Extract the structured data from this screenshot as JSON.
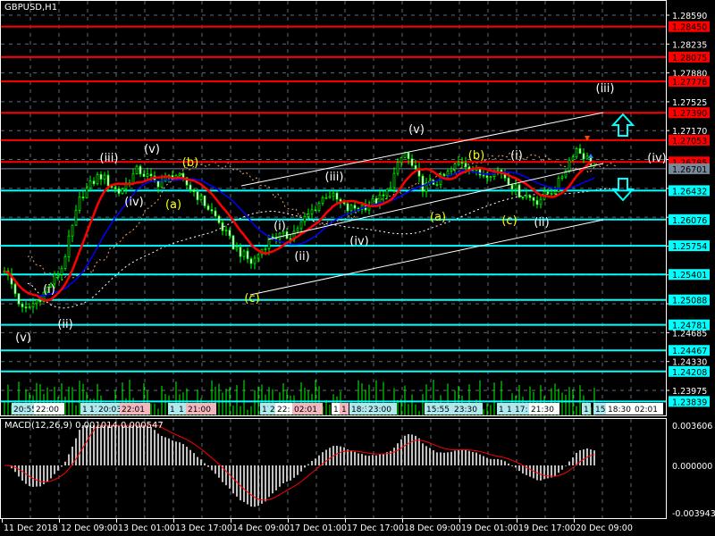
{
  "window": {
    "title": "GBPUSD,H1"
  },
  "macd_title": "MACD(12,26,9) 0.001014 0.000547",
  "colors": {
    "background": "#000000",
    "red_level": "#ff0000",
    "cyan_level": "#00ffff",
    "bull": "#00ff00",
    "wave_white": "#ffffff",
    "wave_yellow": "#ffff00",
    "ma_red": "#ff0000",
    "ma_blue": "#0000ff",
    "histogram": "#c0c0c0",
    "grid": "#5f6b7a"
  },
  "chart_data": {
    "type": "candlestick",
    "symbol": "GBPUSD",
    "timeframe": "H1",
    "ylim": [
      1.2372,
      1.2868
    ],
    "y_ticks": [
      "1.28590",
      "1.28235",
      "1.27880",
      "1.27525",
      "1.27170",
      "1.24685",
      "1.24330",
      "1.23975"
    ],
    "x_ticks": [
      "11 Dec 2018",
      "12 Dec 09:00",
      "13 Dec 01:00",
      "13 Dec 17:00",
      "14 Dec 09:00",
      "17 Dec 01:00",
      "17 Dec 17:00",
      "18 Dec 09:00",
      "19 Dec 01:00",
      "19 Dec 17:00",
      "20 Dec 09:00"
    ],
    "close_anchors": [
      1.2548,
      1.2493,
      1.2515,
      1.2548,
      1.2636,
      1.2663,
      1.2641,
      1.2669,
      1.2652,
      1.2663,
      1.2641,
      1.2614,
      1.2576,
      1.2554,
      1.2587,
      1.2587,
      1.2614,
      1.2641,
      1.262,
      1.2625,
      1.2636,
      1.2691,
      1.2647,
      1.2658,
      1.268,
      1.2663,
      1.2669,
      1.2641,
      1.2631,
      1.2647,
      1.2696,
      1.2674
    ],
    "resistance_levels": [
      "1.28450",
      "1.28075",
      "1.27776",
      "1.27390",
      "1.27053",
      "1.26785"
    ],
    "support_levels": [
      "1.26432",
      "1.26076",
      "1.25754",
      "1.25401",
      "1.25088",
      "1.24781",
      "1.24467",
      "1.24208",
      "1.23839"
    ],
    "current_price": "1.26701",
    "wave_labels": [
      {
        "text": "(iii)",
        "color": "white"
      },
      {
        "text": "(v)",
        "color": "white"
      },
      {
        "text": "(b)",
        "color": "yellow"
      },
      {
        "text": "(iv)",
        "color": "white"
      },
      {
        "text": "(a)",
        "color": "yellow"
      },
      {
        "text": "(i)",
        "color": "white"
      },
      {
        "text": "(ii)",
        "color": "white"
      },
      {
        "text": "(v)",
        "color": "white"
      },
      {
        "text": "(c)",
        "color": "yellow"
      },
      {
        "text": "(i)",
        "color": "white"
      },
      {
        "text": "(ii)",
        "color": "white"
      },
      {
        "text": "(iii)",
        "color": "white"
      },
      {
        "text": "(iv)",
        "color": "white"
      },
      {
        "text": "(v)",
        "color": "white"
      },
      {
        "text": "(b)",
        "color": "yellow"
      },
      {
        "text": "(a)",
        "color": "yellow"
      },
      {
        "text": "(i)",
        "color": "white"
      },
      {
        "text": "(c)",
        "color": "yellow"
      },
      {
        "text": "(ii)",
        "color": "white"
      },
      {
        "text": "(iii)",
        "color": "white"
      },
      {
        "text": "(iv)",
        "color": "white"
      }
    ],
    "session_tags": [
      {
        "text": "20:55",
        "color": "cyan"
      },
      {
        "text": "22:00",
        "color": "white"
      },
      {
        "text": "1",
        "color": "cyan"
      },
      {
        "text": "17",
        "color": "cyan"
      },
      {
        "text": "20:03",
        "color": "cyan"
      },
      {
        "text": "22:01",
        "color": "pink"
      },
      {
        "text": "1",
        "color": "cyan"
      },
      {
        "text": "1",
        "color": "cyan"
      },
      {
        "text": "21:00",
        "color": "pink"
      },
      {
        "text": "17",
        "color": "cyan"
      },
      {
        "text": "2",
        "color": "cyan"
      },
      {
        "text": "22:",
        "color": "white"
      },
      {
        "text": "02:01",
        "color": "pink"
      },
      {
        "text": "1",
        "color": "white"
      },
      {
        "text": "1",
        "color": "pink"
      },
      {
        "text": "18:3",
        "color": "cyan"
      },
      {
        "text": "23:00",
        "color": "cyan"
      },
      {
        "text": "15:55",
        "color": "cyan"
      },
      {
        "text": "23:30",
        "color": "cyan"
      },
      {
        "text": "1",
        "color": "cyan"
      },
      {
        "text": "1",
        "color": "cyan"
      },
      {
        "text": "17:",
        "color": "cyan"
      },
      {
        "text": "21:30",
        "color": "white"
      },
      {
        "text": "1",
        "color": "cyan"
      },
      {
        "text": "15",
        "color": "cyan"
      },
      {
        "text": "18:30",
        "color": "white"
      },
      {
        "text": "02:01",
        "color": "white"
      }
    ],
    "macd": {
      "params": "12,26,9",
      "main": 0.001014,
      "signal": 0.000547,
      "y_ticks": [
        "0.003606",
        "0.000000",
        "-0.003943"
      ],
      "ylim": [
        -0.003943,
        0.003606
      ]
    }
  }
}
